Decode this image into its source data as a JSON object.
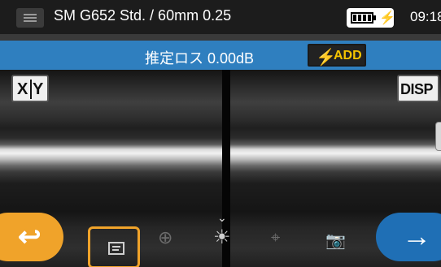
{
  "header": {
    "title": "SM G652 Std. / 60mm 0.25",
    "time": "09:18",
    "icons": [
      "menu-icon",
      "battery-icon",
      "charging-icon"
    ]
  },
  "status_bar": {
    "estimated_loss": "推定ロス  0.00dB",
    "add_label": "ADD",
    "add_icon": "lightning-icon",
    "background_color": "#2f7fbf",
    "add_color": "#f5c400"
  },
  "view": {
    "xy_x": "X",
    "xy_y": "Y",
    "disp_label": "DISP"
  },
  "toolbar": {
    "back_icon": "back-arrow-icon",
    "next_icon": "next-arrow-icon",
    "items": [
      "message-icon",
      "zoom-icon",
      "brightness-icon",
      "focus-icon",
      "camera-icon"
    ],
    "accent_color": "#f0a32a",
    "next_color": "#1f6fb5"
  }
}
